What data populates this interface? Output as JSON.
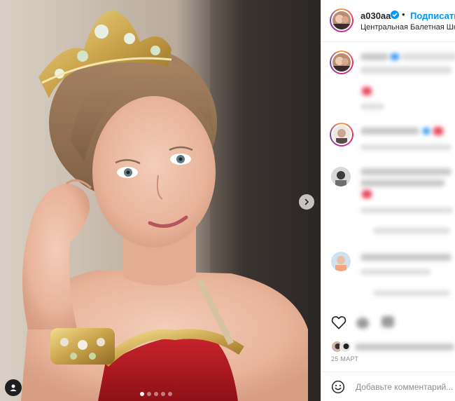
{
  "post": {
    "username": "a030aa",
    "follow_label": "Подписаться",
    "separator": "•",
    "location": "Центральная Балетная Школа",
    "date": "25 МАРТ",
    "comment_placeholder": "Добавьте комментарий..."
  },
  "media": {
    "slides": 5,
    "active_slide": 0
  },
  "icons": {
    "verified": "verified-badge-icon",
    "next": "chevron-right-icon",
    "tagged": "user-tag-icon",
    "like": "heart-icon",
    "comment": "comment-bubble-icon",
    "share": "paper-plane-icon",
    "emoji": "emoji-smile-icon"
  },
  "colors": {
    "link": "#0095f6",
    "text": "#262626",
    "muted": "#8e8e8e",
    "border": "#efefef"
  }
}
